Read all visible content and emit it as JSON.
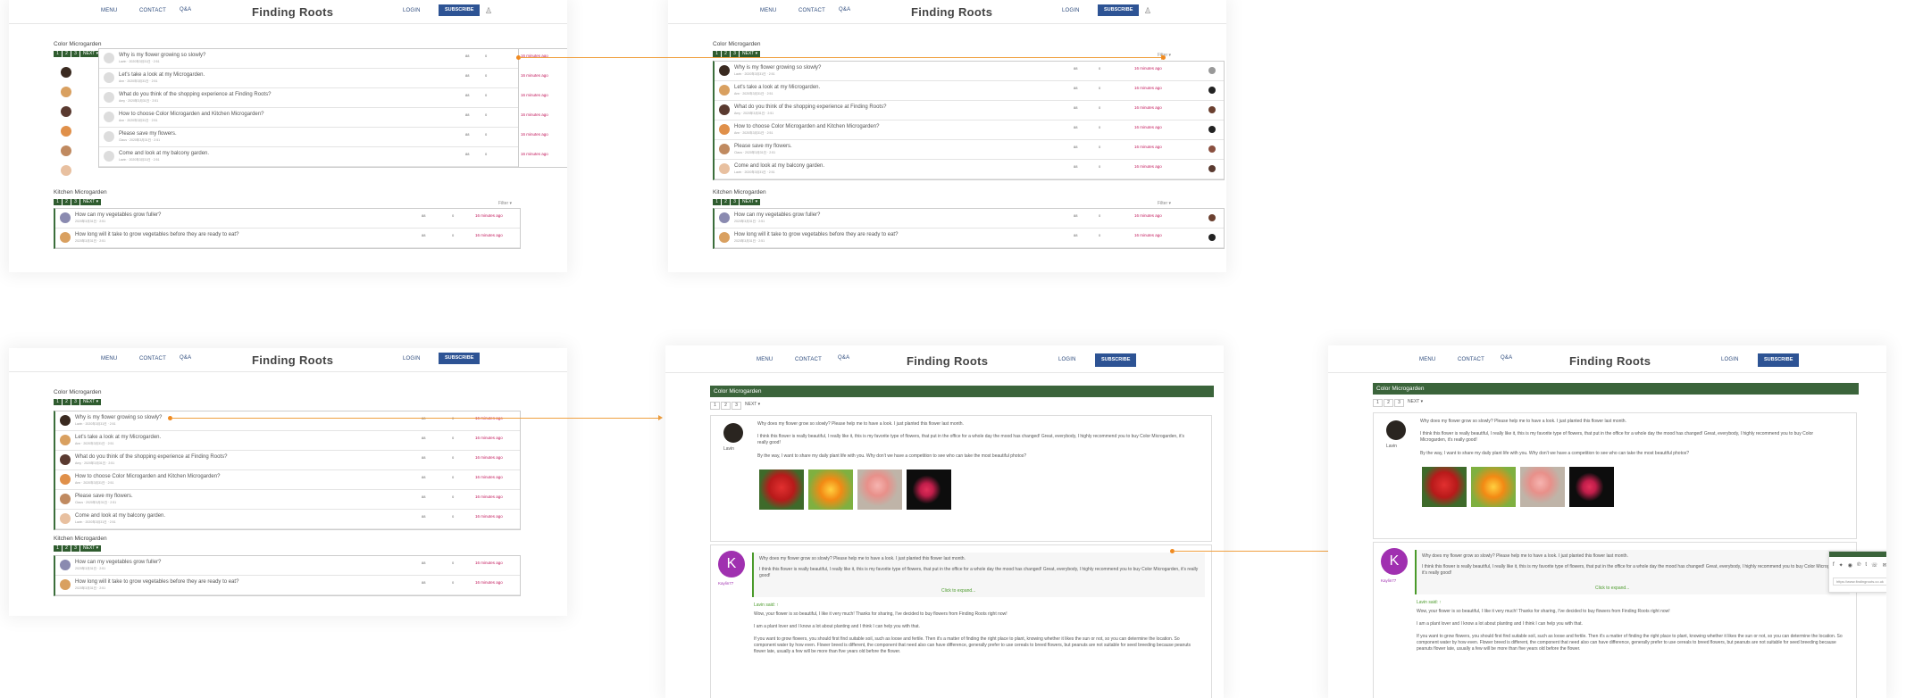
{
  "nav": {
    "menu": "MENU",
    "contact": "CONTACT",
    "qa": "Q&A",
    "brand": "Finding Roots",
    "login": "LOGIN",
    "subscribe": "SUBSCRIBE"
  },
  "sections": {
    "color": "Color Microgarden",
    "kitchen": "Kitchen Microgarden"
  },
  "pager": {
    "p1": "1",
    "p2": "2",
    "p3": "3",
    "next": "NEXT ▾"
  },
  "filter": "Filter ▾",
  "topics": [
    {
      "title": "Why is my flower growing so slowly?",
      "meta": "Lavin · 2020年3月31日 · 2:51",
      "c1": "88",
      "c2": "0",
      "ago": "16 minutes ago"
    },
    {
      "title": "Let's take a look at my Microgarden.",
      "meta": "Ann · 2020年3月31日 · 2:51",
      "c1": "88",
      "c2": "0",
      "ago": "16 minutes ago"
    },
    {
      "title": "What do you think of the shopping experience at Finding Roots?",
      "meta": "Amy · 2020年3月31日 · 2:51",
      "c1": "88",
      "c2": "0",
      "ago": "16 minutes ago"
    },
    {
      "title": "How to choose Color Microgarden and Kitchen Microgarden?",
      "meta": "Ann · 2020年3月31日 · 2:51",
      "c1": "88",
      "c2": "0",
      "ago": "16 minutes ago"
    },
    {
      "title": "Please save my flowers.",
      "meta": "Claus · 2020年3月31日 · 2:51",
      "c1": "88",
      "c2": "0",
      "ago": "16 minutes ago"
    },
    {
      "title": "Come and look at my balcony garden.",
      "meta": "Lavin · 2020年3月31日 · 2:51",
      "c1": "88",
      "c2": "0",
      "ago": "16 minutes ago"
    }
  ],
  "kitchen_topics": [
    {
      "title": "How can my vegetables grow fuller?",
      "meta": "2020年3月31日 · 2:51",
      "c1": "88",
      "c2": "0",
      "ago": "16 minutes ago"
    },
    {
      "title": "How long will it take to grow vegetables before they are ready to eat?",
      "meta": "2020年3月31日 · 2:51",
      "c1": "88",
      "c2": "0",
      "ago": "16 minutes ago"
    }
  ],
  "post": {
    "section": "Color Microgarden",
    "author": "Lavin",
    "q1": "Why does my flower grow so slowly? Please help me to have a look. I just planted this flower last month.",
    "q2": "I think this flower is really beautiful, I really like it, this is my favorite type of flowers, that put in the office for a whole day the mood has changed! Great, everybody, I highly recommend you to buy Color Microgarden, it's really good!",
    "q3": "By the way, I want to share my daily plant life with you. Why don't we have a competition to see who can take the most beautiful photos?",
    "reply_author": "Kaylin77",
    "click_expand": "Click to expand...",
    "said": "Lavin said: ↑",
    "r1": "Wow, your flower is so beautiful, I like it very much! Thanks for sharing, I've decided to buy flowers from Finding Roots right now!",
    "r2": "I am a plant lover and I know a lot about planting and I think I can help you with that.",
    "r3": "If you want to grow flowers, you should first find suitable soil, such as loose and fertile. Then it's a matter of finding the right place to plant, knowing whether it likes the sun or not, so you can determine the location. So component water by how even. Flower breed is different, the component that need also can have difference, generally prefer to use cereals to breed flowers, but peanuts are not suitable for seed breeding because peanuts flower late, usually a few will be more than five years old before the flower.",
    "url": "https://www.findingroots.co.uk"
  },
  "colors": {
    "green": "#3b643b",
    "brand_blue": "#2d5394",
    "accent_pink": "#c2185b",
    "arrow": "#f0a040"
  }
}
